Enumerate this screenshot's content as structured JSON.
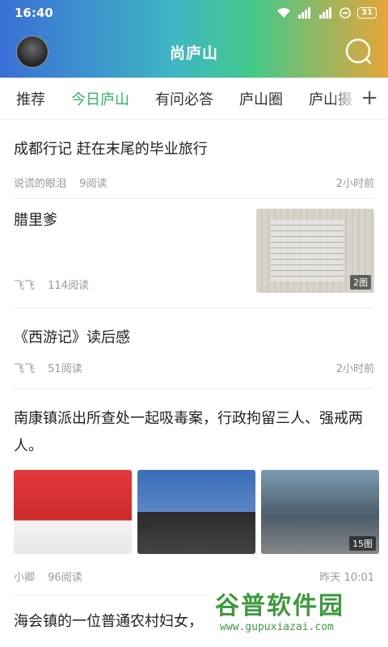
{
  "status_bar": {
    "time": "16:40",
    "battery": "31",
    "wifi_icon": "wifi-icon",
    "signal_icon": "signal-icon"
  },
  "header": {
    "title": "尚庐山",
    "avatar_icon": "avatar",
    "search_icon": "search-icon"
  },
  "tabs": [
    {
      "label": "推荐",
      "active": false
    },
    {
      "label": "今日庐山",
      "active": true
    },
    {
      "label": "有问必答",
      "active": false
    },
    {
      "label": "庐山圈",
      "active": false
    },
    {
      "label": "庐山摄",
      "active": false
    }
  ],
  "add_tab": "+",
  "feed": [
    {
      "title": "成都行记 赶在末尾的毕业旅行",
      "author": "说谎的眼泪",
      "reads": "9阅读",
      "time": "2小时前"
    },
    {
      "title": "腊里爹",
      "author": "飞飞",
      "reads": "114阅读",
      "time": "",
      "image_count": "2图"
    },
    {
      "title": "《西游记》读后感",
      "author": "飞飞",
      "reads": "51阅读",
      "time": "2小时前"
    },
    {
      "title": "南康镇派出所查处一起吸毒案，行政拘留三人、强戒两人。",
      "author": "小卿",
      "reads": "96阅读",
      "time": "昨天 10:01",
      "image_count": "15图"
    },
    {
      "title": "海会镇的一位普通农村妇女，"
    }
  ],
  "watermark": {
    "brand": "谷普软件园",
    "url": "www.gupuxiazai.com"
  },
  "colors": {
    "accent": "#2fb36a",
    "header_gradient_start": "#3a6fd6",
    "header_gradient_end": "#e6a53a"
  }
}
